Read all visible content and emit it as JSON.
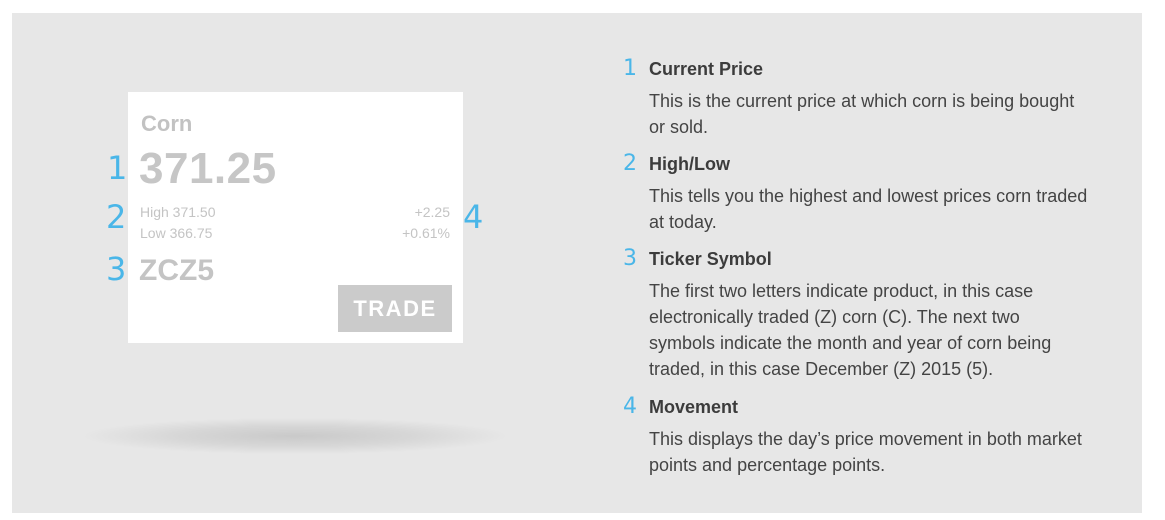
{
  "colors": {
    "background": "#e7e7e7",
    "card": "#ffffff",
    "accent_number": "#4ab6e8",
    "card_text": "#c4c4c4",
    "trade_button": "#cbcbcb"
  },
  "card": {
    "name": "Corn",
    "price": "371.25",
    "high": "High 371.50",
    "low": "Low 366.75",
    "change_points": "+2.25",
    "change_percent": "+0.61%",
    "ticker": "ZCZ5",
    "trade_label": "TRADE"
  },
  "callouts": [
    "1",
    "2",
    "3",
    "4"
  ],
  "legend": [
    {
      "number": "1",
      "title": "Current Price",
      "description": "This is the current price at which corn is being bought or sold."
    },
    {
      "number": "2",
      "title": "High/Low",
      "description": "This tells you the highest and lowest prices corn traded at today."
    },
    {
      "number": "3",
      "title": "Ticker Symbol",
      "description": "The first two letters indicate product, in this case electronically traded (Z) corn (C). The next two symbols indicate the month and year of corn being traded, in this case December (Z) 2015 (5)."
    },
    {
      "number": "4",
      "title": "Movement",
      "description": "This displays the day’s price movement in both market points and percentage points."
    }
  ]
}
